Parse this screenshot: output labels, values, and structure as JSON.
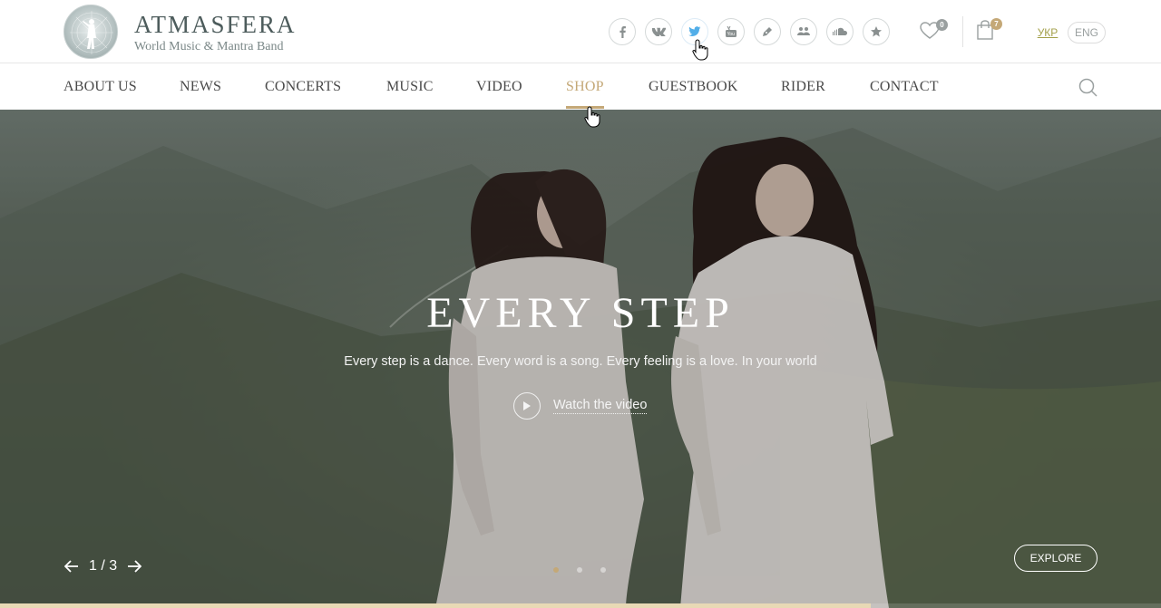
{
  "brand": {
    "title": "ATMASFERA",
    "subtitle": "World Music & Mantra Band"
  },
  "socials": [
    {
      "name": "facebook-icon",
      "glyph": "f"
    },
    {
      "name": "vk-icon",
      "glyph": "vk"
    },
    {
      "name": "twitter-icon",
      "glyph": ""
    },
    {
      "name": "youtube-icon",
      "glyph": ""
    },
    {
      "name": "pen-icon",
      "glyph": ""
    },
    {
      "name": "community-icon",
      "glyph": ""
    },
    {
      "name": "soundcloud-icon",
      "glyph": ""
    },
    {
      "name": "star-icon",
      "glyph": "★"
    }
  ],
  "wishlist_count": "0",
  "cart_count": "7",
  "languages": {
    "ukr": "УКР",
    "eng": "ENG"
  },
  "nav": [
    "ABOUT US",
    "NEWS",
    "CONCERTS",
    "MUSIC",
    "VIDEO",
    "SHOP",
    "GUESTBOOK",
    "RIDER",
    "CONTACT"
  ],
  "active_nav": "SHOP",
  "hero": {
    "title": "EVERY STEP",
    "subtitle": "Every step is a dance. Every word is a song. Every feeling is a love. In your  world",
    "watch_label": "Watch the video",
    "counter": "1 / 3",
    "explore_label": "EXPLORE",
    "progress": 0.75
  },
  "colors": {
    "accent": "#c4a877",
    "twitter": "#52aee8",
    "ukr": "#a3a04a"
  }
}
